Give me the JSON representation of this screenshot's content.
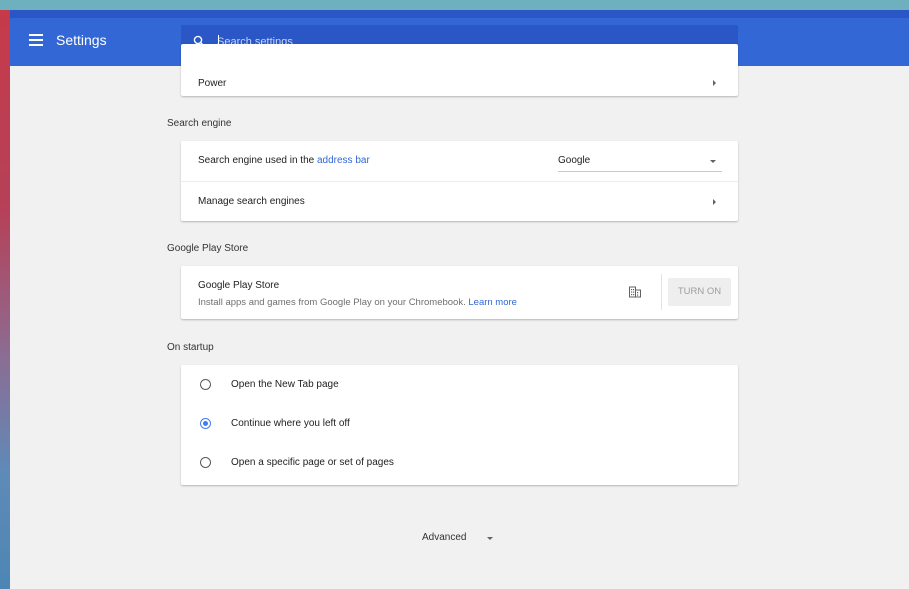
{
  "header": {
    "title": "Settings",
    "search_placeholder": "Search settings"
  },
  "power": {
    "label": "Power"
  },
  "search_engine": {
    "section_title": "Search engine",
    "used_in_prefix": "Search engine used in the ",
    "used_in_link": "address bar",
    "selected_engine": "Google",
    "manage_label": "Manage search engines"
  },
  "play_store": {
    "section_title": "Google Play Store",
    "item_title": "Google Play Store",
    "description": "Install apps and games from Google Play on your Chromebook.",
    "learn_more": "Learn more",
    "turn_on_label": "TURN ON"
  },
  "on_startup": {
    "section_title": "On startup",
    "options": [
      {
        "label": "Open the New Tab page",
        "selected": false
      },
      {
        "label": "Continue where you left off",
        "selected": true
      },
      {
        "label": "Open a specific page or set of pages",
        "selected": false
      }
    ]
  },
  "advanced": {
    "label": "Advanced"
  },
  "colors": {
    "accent": "#3367d6",
    "toolbar": "#3367d6",
    "search_box": "#2a56c6",
    "radio_selected": "#3f7ff2",
    "page_background": "#f1f1f1"
  },
  "icons": {
    "menu": "hamburger-menu-icon",
    "search": "search-icon",
    "store": "store-building-icon"
  }
}
